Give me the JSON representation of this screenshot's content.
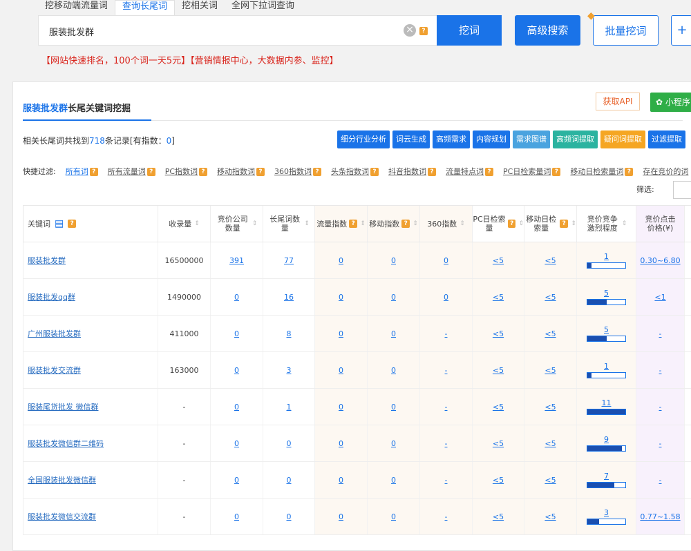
{
  "tabs": [
    "挖移动端流量词",
    "查询长尾词",
    "挖相关词",
    "全网下拉词查询"
  ],
  "active_tab": 1,
  "search": {
    "value": "服装批发群",
    "dig_label": "挖词",
    "advanced_label": "高级搜索",
    "batch_label": "批量挖词",
    "plus_label": "+"
  },
  "promo_text": "【网站快速排名，100个词一天5元】【营销情报中心，大数据内参、监控】",
  "panel": {
    "title_keyword": "服装批发群",
    "title_suffix": "长尾关键词挖掘",
    "api_label": "获取API",
    "mini_label": "小程序",
    "count_prefix": "相关长尾词共找到",
    "count_value": "718",
    "count_suffix": "条记录[有指数：",
    "count_index": "0",
    "count_end": "]"
  },
  "toolbar": [
    {
      "label": "细分行业分析",
      "color": "#1a73e8"
    },
    {
      "label": "词云生成",
      "color": "#1a73e8"
    },
    {
      "label": "高频需求",
      "color": "#1a73e8"
    },
    {
      "label": "内容规划",
      "color": "#1a73e8"
    },
    {
      "label": "需求图谱",
      "color": "#4aa3df"
    },
    {
      "label": "高频词提取",
      "color": "#2bb3a0"
    },
    {
      "label": "疑问词提取",
      "color": "#f5a623"
    },
    {
      "label": "过滤提取",
      "color": "#1a73e8"
    }
  ],
  "filters": {
    "label": "快捷过滤:",
    "items": [
      "所有词",
      "所有流量词",
      "PC指数词",
      "移动指数词",
      "360指数词",
      "头条指数词",
      "抖音指数词",
      "流量特点词",
      "PC日检索量词",
      "移动日检索量词",
      "存在竞价的词"
    ]
  },
  "screen_label": "筛选:",
  "columns": [
    "关键词",
    "收录量",
    "竞价公司数量",
    "长尾词数量",
    "流量指数",
    "移动指数",
    "360指数",
    "PC日检索量",
    "移动日检索量",
    "竞价竞争激烈程度",
    "竞价点击价格(¥)"
  ],
  "rows": [
    {
      "kw": "服装批发群",
      "shoulu": "16500000",
      "jingjia": "391",
      "changwei": "77",
      "liuliang": "0",
      "yidong": "0",
      "s360": "0",
      "pc": "<5",
      "mobile": "<5",
      "comp": 1,
      "price": "0.30~6.80"
    },
    {
      "kw": "服装批发qq群",
      "shoulu": "1490000",
      "jingjia": "0",
      "changwei": "16",
      "liuliang": "0",
      "yidong": "0",
      "s360": "0",
      "pc": "<5",
      "mobile": "<5",
      "comp": 5,
      "price": "<1"
    },
    {
      "kw": "广州服装批发群",
      "shoulu": "411000",
      "jingjia": "0",
      "changwei": "8",
      "liuliang": "0",
      "yidong": "0",
      "s360": "-",
      "pc": "<5",
      "mobile": "<5",
      "comp": 5,
      "price": "-"
    },
    {
      "kw": "服装批发交流群",
      "shoulu": "163000",
      "jingjia": "0",
      "changwei": "3",
      "liuliang": "0",
      "yidong": "0",
      "s360": "-",
      "pc": "<5",
      "mobile": "<5",
      "comp": 1,
      "price": "-"
    },
    {
      "kw": "服装尾货批发 微信群",
      "shoulu": "-",
      "jingjia": "0",
      "changwei": "1",
      "liuliang": "0",
      "yidong": "0",
      "s360": "-",
      "pc": "<5",
      "mobile": "<5",
      "comp": 11,
      "price": "-"
    },
    {
      "kw": "服装批发微信群二维码",
      "shoulu": "-",
      "jingjia": "0",
      "changwei": "0",
      "liuliang": "0",
      "yidong": "0",
      "s360": "-",
      "pc": "<5",
      "mobile": "<5",
      "comp": 9,
      "price": "-"
    },
    {
      "kw": "全国服装批发微信群",
      "shoulu": "-",
      "jingjia": "0",
      "changwei": "0",
      "liuliang": "0",
      "yidong": "0",
      "s360": "-",
      "pc": "<5",
      "mobile": "<5",
      "comp": 7,
      "price": "-"
    },
    {
      "kw": "服装批发微信交流群",
      "shoulu": "-",
      "jingjia": "0",
      "changwei": "0",
      "liuliang": "0",
      "yidong": "0",
      "s360": "-",
      "pc": "<5",
      "mobile": "<5",
      "comp": 3,
      "price": "0.77~1.58"
    }
  ]
}
